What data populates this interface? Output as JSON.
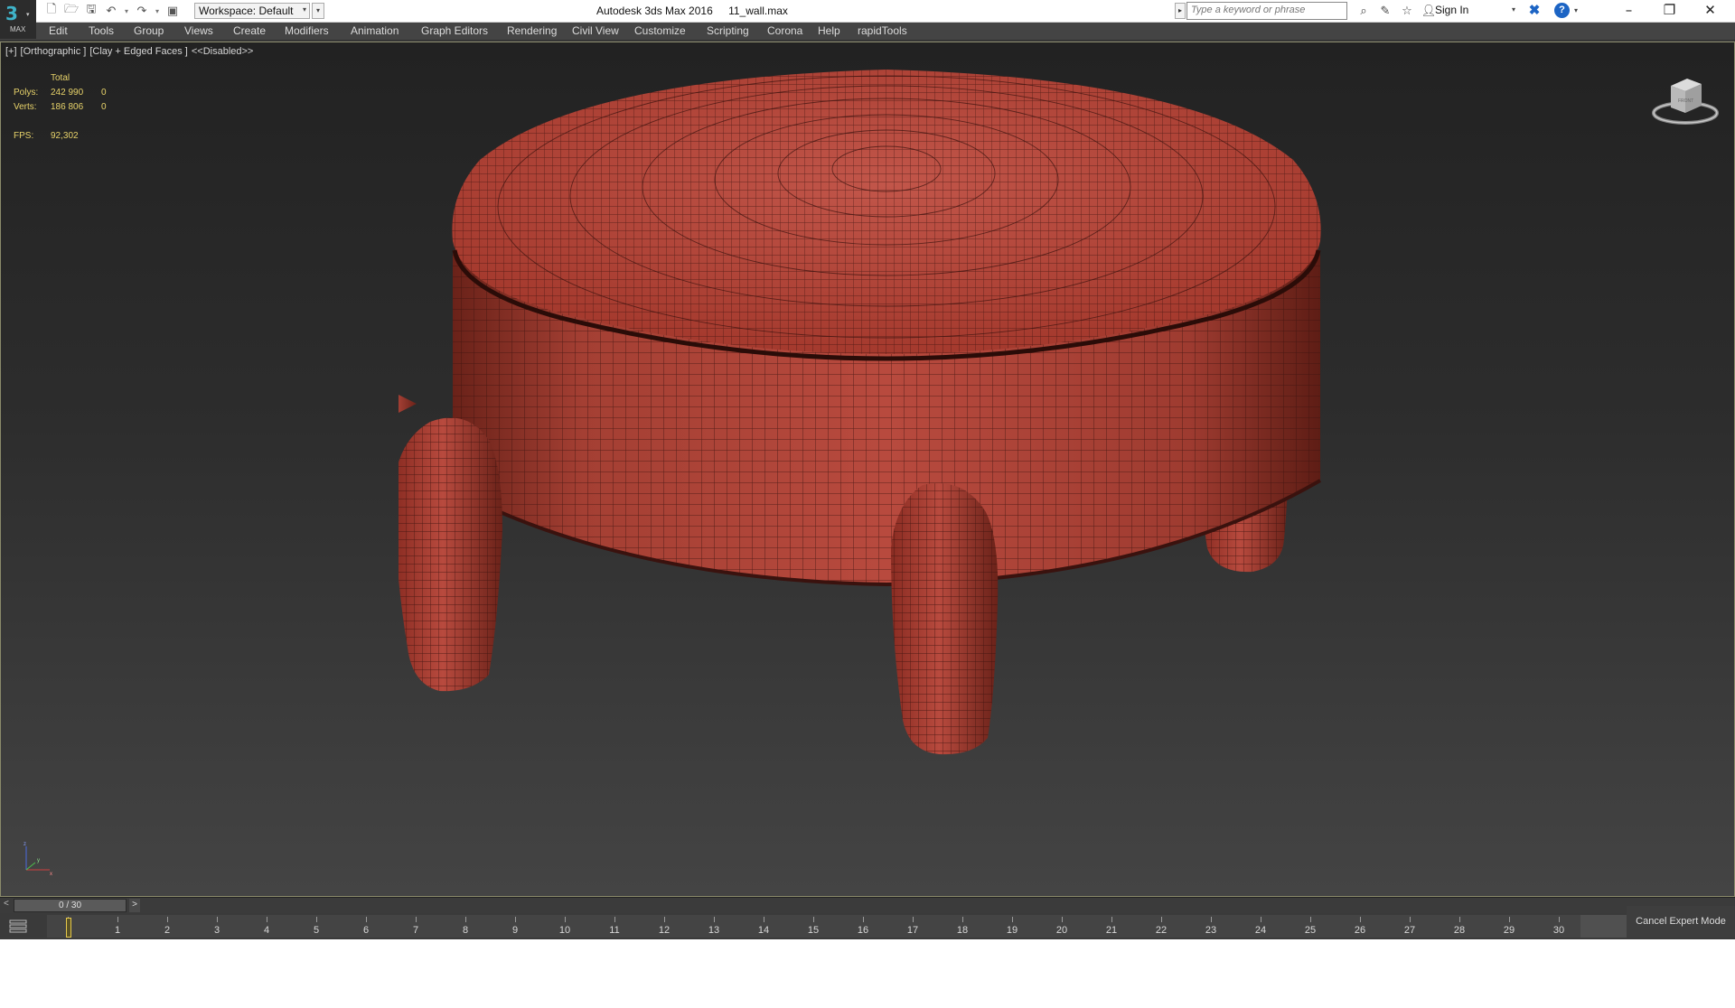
{
  "app": {
    "logo_text": "MAX",
    "title": "Autodesk 3ds Max 2016",
    "file": "11_wall.max"
  },
  "quick_access": {
    "icons": [
      "new-file-icon",
      "open-file-icon",
      "save-icon",
      "undo-icon",
      "redo-icon",
      "project-folder-icon"
    ],
    "workspace_value": "Workspace: Default"
  },
  "search": {
    "placeholder": "Type a keyword or phrase"
  },
  "infocenter": {
    "icons": [
      "binoculars-icon",
      "communication-center-icon",
      "favorites-star-icon",
      "user-icon"
    ],
    "sign_in": "Sign In"
  },
  "window_controls": {
    "minimize": "–",
    "restore": "❐",
    "close": "✕"
  },
  "menu": [
    "Edit",
    "Tools",
    "Group",
    "Views",
    "Create",
    "Modifiers",
    "Animation",
    "Graph Editors",
    "Rendering",
    "Civil View",
    "Customize",
    "Scripting",
    "Corona",
    "Help",
    "rapidTools"
  ],
  "viewport": {
    "label_parts": [
      "[+]",
      "[Orthographic ]",
      "[Clay + Edged Faces ]",
      "<<Disabled>>"
    ],
    "stats": {
      "header": "Total",
      "polys_label": "Polys:",
      "polys_total": "242 990",
      "polys_selected": "0",
      "verts_label": "Verts:",
      "verts_total": "186 806",
      "verts_selected": "0",
      "fps_label": "FPS:",
      "fps_value": "92,302"
    },
    "viewcube_face": "FRONT",
    "model_color": "#b5473c",
    "wire_color": "#3a120e"
  },
  "timeline": {
    "prev": "<",
    "next": ">",
    "slider_text": "0 / 30",
    "frames": [
      "0",
      "1",
      "2",
      "3",
      "4",
      "5",
      "6",
      "7",
      "8",
      "9",
      "10",
      "11",
      "12",
      "13",
      "14",
      "15",
      "16",
      "17",
      "18",
      "19",
      "20",
      "21",
      "22",
      "23",
      "24",
      "25",
      "26",
      "27",
      "28",
      "29",
      "30"
    ],
    "current_frame": 0
  },
  "status": {
    "cancel_expert_mode": "Cancel Expert Mode"
  }
}
